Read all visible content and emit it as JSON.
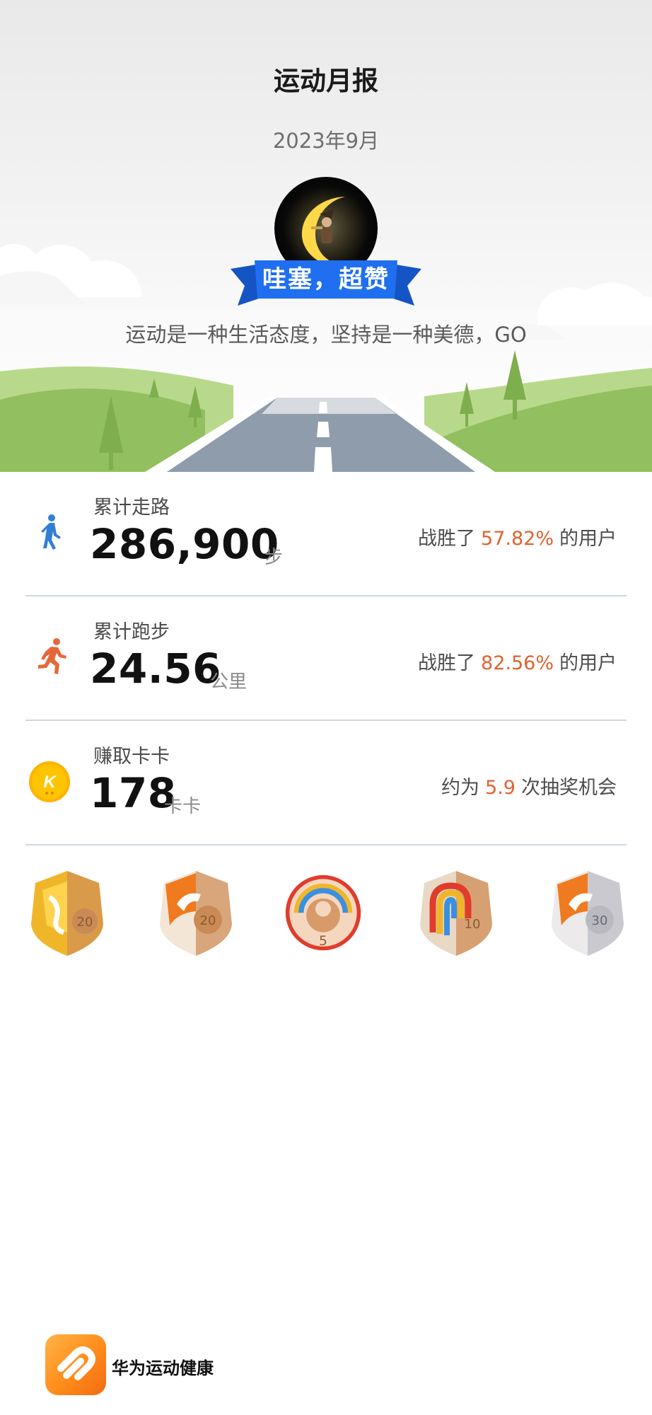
{
  "header": {
    "title": "运动月报",
    "month": "2023年9月"
  },
  "hero": {
    "banner_text": "哇塞，超赞",
    "slogan": "运动是一种生活态度，坚持是一种美德，GO"
  },
  "stats": [
    {
      "icon": "walking-person-icon",
      "label": "累计走路",
      "value": "286,900",
      "unit": "步",
      "right_prefix": "战胜了",
      "right_value": "57.82%",
      "right_suffix": "的用户"
    },
    {
      "icon": "running-person-icon",
      "label": "累计跑步",
      "value": "24.56",
      "unit": "公里",
      "right_prefix": "战胜了",
      "right_value": "82.56%",
      "right_suffix": "的用户"
    },
    {
      "icon": "kaka-coin-icon",
      "label": "赚取卡卡",
      "value": "178",
      "unit": "卡卡",
      "right_prefix": "约为",
      "right_value": "5.9",
      "right_suffix": "次抽奖机会"
    }
  ],
  "badges": [
    {
      "icon": "walking-20-badge-icon",
      "number": "20"
    },
    {
      "icon": "running-20-badge-icon",
      "number": "20"
    },
    {
      "icon": "ring-5-badge-icon",
      "number": "5"
    },
    {
      "icon": "rainbow-10-badge-icon",
      "number": "10"
    },
    {
      "icon": "running-30-badge-icon",
      "number": "30"
    }
  ],
  "footer": {
    "app_name": "华为运动健康"
  },
  "colors": {
    "highlight": "#e0622f",
    "walk_icon": "#2f7fd6",
    "run_icon": "#e8673a",
    "coin": "#ffc400",
    "banner": "#1e6fe8",
    "brand": "#ff8c1a"
  }
}
